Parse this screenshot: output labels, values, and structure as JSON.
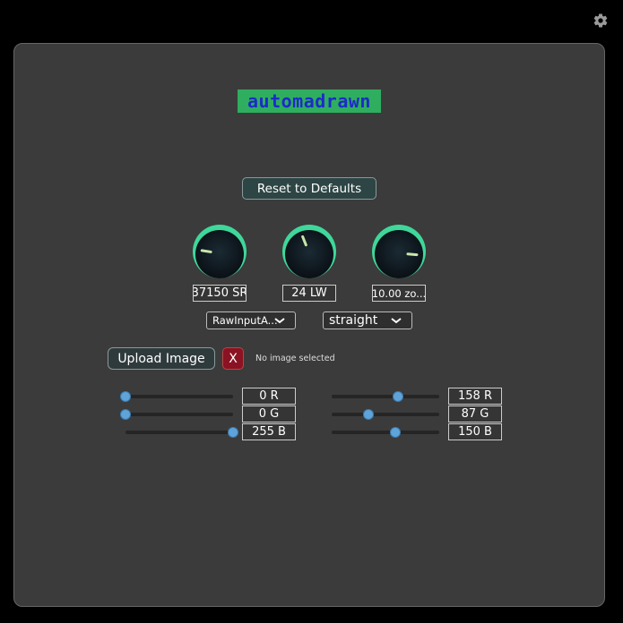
{
  "settings": {
    "icon": "gear-icon"
  },
  "logo": {
    "text": "automadrawn"
  },
  "reset_button": {
    "label": "Reset to Defaults"
  },
  "knobs": [
    {
      "value": "37150 SR",
      "level": 0.2
    },
    {
      "value": "24 LW",
      "level": 0.42
    },
    {
      "value": "10.00 zo...",
      "level": 0.85
    }
  ],
  "dropdowns": {
    "input_source": {
      "selected": "RawInputA..."
    },
    "line_style": {
      "selected": "straight"
    }
  },
  "upload": {
    "label": "Upload Image",
    "clear_label": "X",
    "status": "No image selected"
  },
  "color_left": {
    "r": {
      "label": "0 R",
      "value": 0
    },
    "g": {
      "label": "0 G",
      "value": 0
    },
    "b": {
      "label": "255 B",
      "value": 255
    }
  },
  "color_right": {
    "r": {
      "label": "158 R",
      "value": 158
    },
    "g": {
      "label": "87 G",
      "value": 87
    },
    "b": {
      "label": "150 B",
      "value": 150
    }
  },
  "colors": {
    "background": "#3b3b3b",
    "knob_ring": "#3fd79a",
    "slider_thumb": "#5fa3d8",
    "logo_bg": "#2fae5f",
    "logo_text": "#1c2bc8"
  }
}
